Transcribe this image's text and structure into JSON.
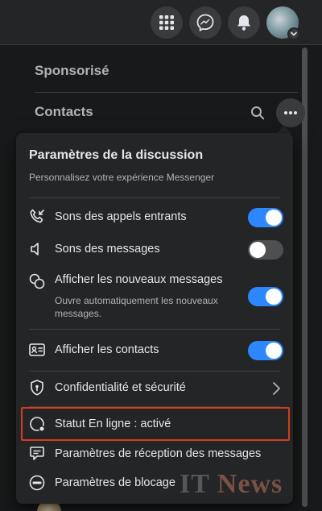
{
  "topbar": {
    "menu_icon": "grid-menu-icon",
    "messenger_icon": "messenger-icon",
    "notifications_icon": "bell-icon",
    "account_badge_icon": "chevron-down-icon"
  },
  "sidebar": {
    "sponsored_title": "Sponsorisé",
    "contacts_title": "Contacts",
    "search_icon": "search-icon",
    "more_icon": "more-options-icon"
  },
  "popup": {
    "title": "Paramètres de la discussion",
    "subtitle": "Personnalisez votre expérience Messenger",
    "items": [
      {
        "icon": "incoming-call-icon",
        "label": "Sons des appels entrants",
        "control": "toggle",
        "toggle_on": true
      },
      {
        "icon": "speaker-icon",
        "label": "Sons des messages",
        "control": "toggle",
        "toggle_on": false
      },
      {
        "icon": "chat-bubbles-icon",
        "label": "Afficher les nouveaux messages",
        "description": "Ouvre automatiquement les nouveaux messages.",
        "control": "toggle",
        "toggle_on": true
      },
      {
        "icon": "contact-card-icon",
        "label": "Afficher les contacts",
        "control": "toggle",
        "toggle_on": true
      },
      {
        "icon": "shield-lock-icon",
        "label": "Confidentialité et sécurité",
        "control": "chevron"
      },
      {
        "icon": "online-status-icon",
        "label": "Statut En ligne : activé",
        "highlighted": true
      },
      {
        "icon": "message-requests-icon",
        "label": "Paramètres de réception des messages"
      },
      {
        "icon": "block-icon",
        "label": "Paramètres de blocage"
      }
    ]
  },
  "watermark": {
    "part1": "IT",
    "part2": "News"
  },
  "colors": {
    "accent": "#2d88ff",
    "highlight_border": "#d63a20",
    "popup_bg": "#242526",
    "page_bg": "#18191a"
  }
}
